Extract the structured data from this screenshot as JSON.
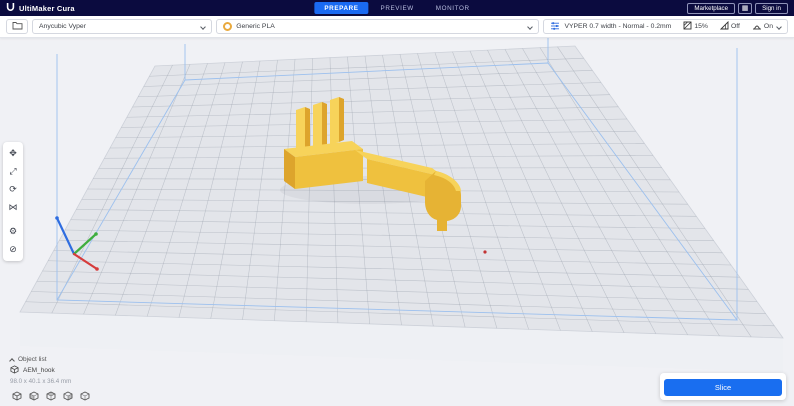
{
  "titlebar": {
    "app_name": "UltiMaker Cura",
    "tabs": [
      {
        "label": "PREPARE",
        "active": true
      },
      {
        "label": "PREVIEW",
        "active": false
      },
      {
        "label": "MONITOR",
        "active": false
      }
    ],
    "marketplace_label": "Marketplace",
    "apps_glyph": "▦",
    "signin_label": "Sign in"
  },
  "config_bar": {
    "printer_name": "Anycubic Vyper",
    "material_name": "Generic PLA",
    "profile_summary": "VYPER 0.7 width - Normal - 0.2mm",
    "infill_value": "15%",
    "support_value": "Off",
    "adhesion_value": "On"
  },
  "tools": [
    {
      "name": "move",
      "glyph": "✥"
    },
    {
      "name": "scale",
      "glyph": "⤢"
    },
    {
      "name": "rotate",
      "glyph": "⟳"
    },
    {
      "name": "mirror",
      "glyph": "⋈"
    },
    {
      "name": "per-model-settings",
      "glyph": "⚙"
    },
    {
      "name": "support-blocker",
      "glyph": "⊘"
    }
  ],
  "scene": {
    "object_list_label": "Object list",
    "model_name": "AEM_hook",
    "model_dimensions": "98.0 x 40.1 x 36.4 mm",
    "slice_label": "Slice",
    "colors": {
      "model_light": "#f7d35a",
      "model_mid": "#efc13e",
      "model_dark": "#dda42c",
      "build_volume_line": "#9cc0ee",
      "accent_blue": "#196ef0",
      "axis_x": "#d63c3c",
      "axis_y": "#3fae3f",
      "axis_z": "#2f6de0"
    }
  }
}
